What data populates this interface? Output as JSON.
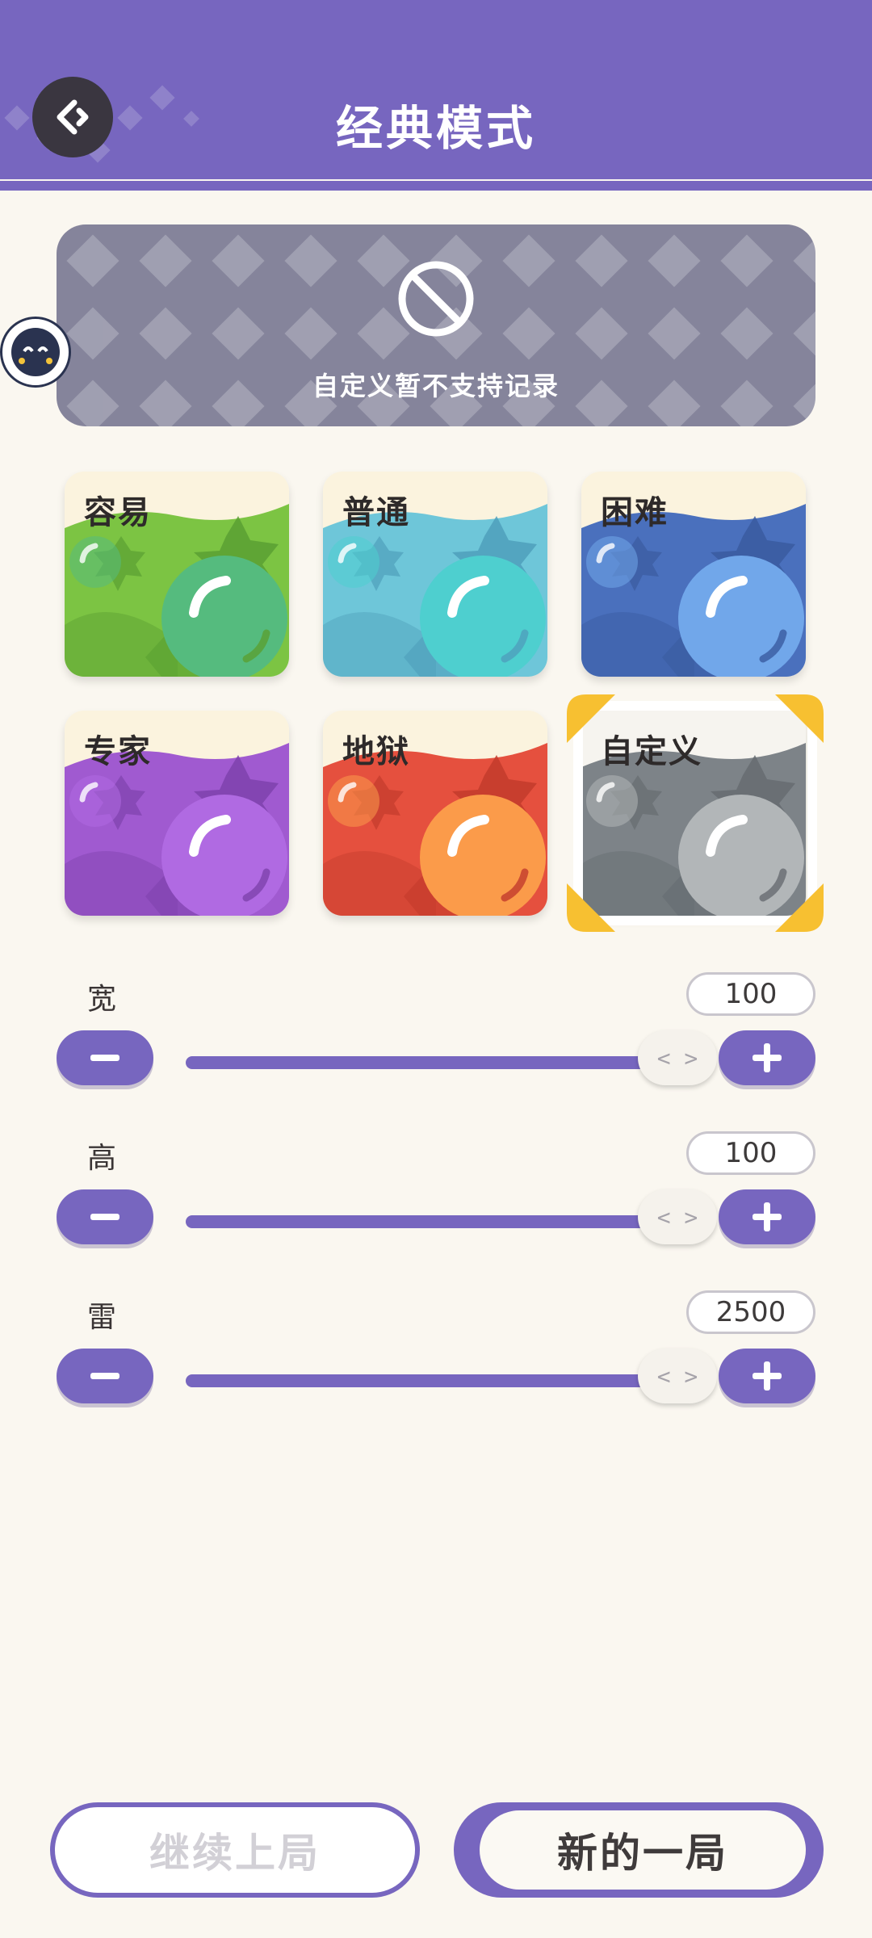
{
  "header": {
    "title": "经典模式"
  },
  "notice": {
    "text": "自定义暂不支持记录",
    "icon": "prohibited-icon"
  },
  "difficulties": [
    {
      "label": "容易",
      "key": "easy",
      "colors": {
        "bg": "#7cc443",
        "dark": "#5aa032",
        "ball": "#55bb7e",
        "band": "#fbf3de"
      }
    },
    {
      "label": "普通",
      "key": "normal",
      "colors": {
        "bg": "#6ec6d9",
        "dark": "#4f9fbb",
        "ball": "#4ecfcf",
        "band": "#fbf3de"
      }
    },
    {
      "label": "困难",
      "key": "hard",
      "colors": {
        "bg": "#4a70bd",
        "dark": "#3a5ba0",
        "ball": "#71a7ea",
        "band": "#fbf3de"
      }
    },
    {
      "label": "专家",
      "key": "expert",
      "colors": {
        "bg": "#a05ad0",
        "dark": "#7e42ad",
        "ball": "#b06ae2",
        "band": "#fbf3de"
      }
    },
    {
      "label": "地狱",
      "key": "hell",
      "colors": {
        "bg": "#e5503e",
        "dark": "#c33b2c",
        "ball": "#fb9b4a",
        "band": "#fbf3de"
      }
    },
    {
      "label": "自定义",
      "key": "custom",
      "selected": true,
      "colors": {
        "bg": "#7d8388",
        "dark": "#666c71",
        "ball": "#b2b6b8",
        "band": "#f6f4ef"
      }
    }
  ],
  "sliders": [
    {
      "label": "宽",
      "value": "100",
      "fill_fraction": 1.0
    },
    {
      "label": "高",
      "value": "100",
      "fill_fraction": 1.0
    },
    {
      "label": "雷",
      "value": "2500",
      "fill_fraction": 1.0
    }
  ],
  "buttons": {
    "continue": "继续上局",
    "new_game": "新的一局"
  },
  "theme": {
    "accent": "#7766bf",
    "selected_corner": "#f7c031"
  }
}
